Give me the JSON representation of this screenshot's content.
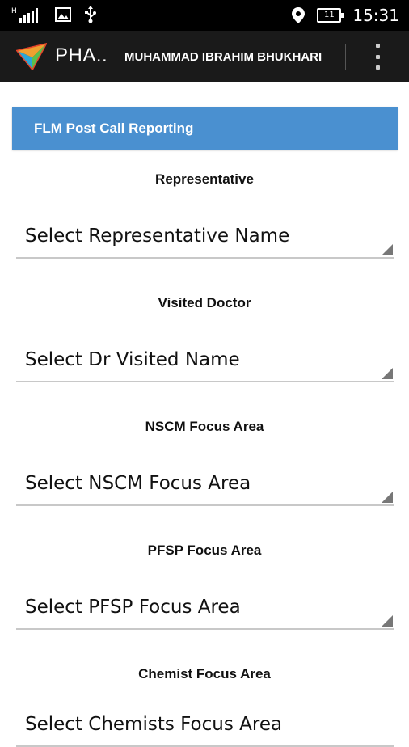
{
  "status_bar": {
    "time": "15:31",
    "battery_level": "11",
    "icons": [
      "signal-icon",
      "image-icon",
      "usb-icon",
      "location-icon",
      "battery-icon"
    ]
  },
  "action_bar": {
    "app_title": "PHA..",
    "user_name": "MUHAMMAD IBRAHIM BHUKHARI",
    "icons": [
      "app-logo-icon",
      "overflow-menu-icon"
    ]
  },
  "form": {
    "header": "FLM Post Call Reporting",
    "fields": [
      {
        "label": "Representative",
        "value": "Select Representative Name"
      },
      {
        "label": "Visited Doctor",
        "value": "Select Dr Visited Name"
      },
      {
        "label": "NSCM Focus Area",
        "value": "Select NSCM Focus Area"
      },
      {
        "label": "PFSP Focus Area",
        "value": "Select PFSP Focus Area"
      },
      {
        "label": "Chemist Focus Area",
        "value": "Select Chemists Focus Area"
      }
    ]
  },
  "colors": {
    "header_bg": "#4a90d0",
    "action_bar_bg": "#1a1a1a",
    "status_bar_bg": "#000000"
  }
}
